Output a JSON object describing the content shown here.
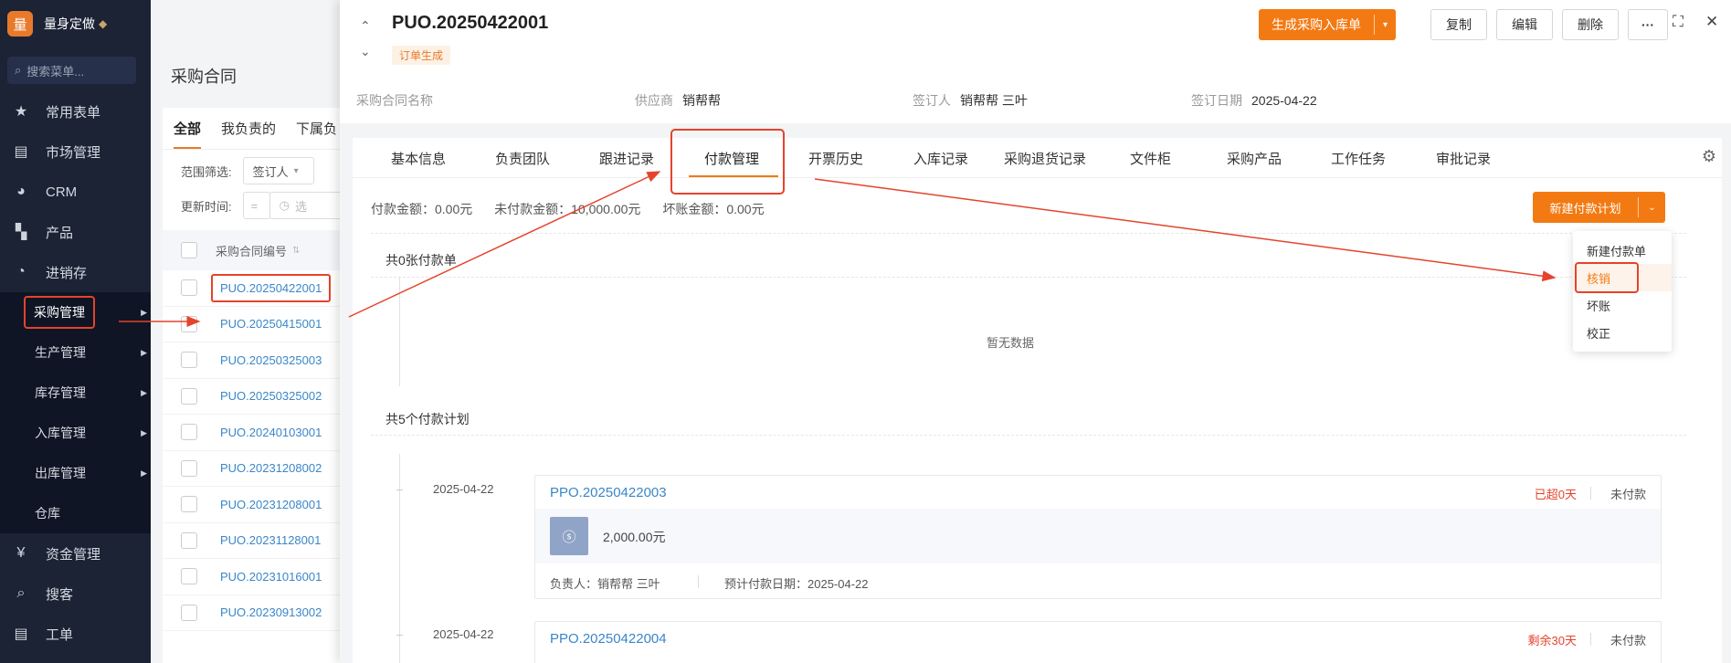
{
  "brand": {
    "logo_char": "量",
    "name": "量身定做"
  },
  "sidebar": {
    "search_placeholder": "搜索菜单...",
    "items": [
      {
        "label": "常用表单",
        "icon": "star-icon"
      },
      {
        "label": "市场管理",
        "icon": "clipboard-icon"
      },
      {
        "label": "CRM",
        "icon": "pie-icon"
      },
      {
        "label": "产品",
        "icon": "blocks-icon"
      },
      {
        "label": "进销存",
        "icon": "dashboard-icon"
      }
    ],
    "sub_items": [
      {
        "label": "采购管理",
        "has_arrow": true
      },
      {
        "label": "生产管理",
        "has_arrow": true
      },
      {
        "label": "库存管理",
        "has_arrow": true
      },
      {
        "label": "入库管理",
        "has_arrow": true
      },
      {
        "label": "出库管理",
        "has_arrow": true
      },
      {
        "label": "仓库",
        "has_arrow": false
      }
    ],
    "bottom_items": [
      {
        "label": "资金管理",
        "icon": "money-icon"
      },
      {
        "label": "搜客",
        "icon": "search-icon"
      },
      {
        "label": "工单",
        "icon": "clipboard-icon"
      }
    ]
  },
  "list_page": {
    "title": "采购合同",
    "tabs": [
      "全部",
      "我负责的",
      "下属负"
    ],
    "filter_label": "范围筛选:",
    "filter_value": "签订人",
    "time_label": "更新时间:",
    "date_placeholder": "选",
    "column_header": "采购合同编号",
    "rows": [
      "PUO.20250422001",
      "PUO.20250415001",
      "PUO.20250325003",
      "PUO.20250325002",
      "PUO.20240103001",
      "PUO.20231208002",
      "PUO.20231208001",
      "PUO.20231128001",
      "PUO.20231016001",
      "PUO.20230913002"
    ]
  },
  "detail": {
    "code": "PUO.20250422001",
    "status": "订单生成",
    "buttons": {
      "primary": "生成采购入库单",
      "copy": "复制",
      "edit": "编辑",
      "delete": "删除",
      "more": "···"
    },
    "info": {
      "contract_name_label": "采购合同名称",
      "contract_name_value": "",
      "supplier_label": "供应商",
      "supplier_value": "销帮帮",
      "signer_label": "签订人",
      "signer_value": "销帮帮 三叶",
      "date_label": "签订日期",
      "date_value": "2025-04-22"
    },
    "tabs": [
      "基本信息",
      "负责团队",
      "跟进记录",
      "付款管理",
      "开票历史",
      "入库记录",
      "采购退货记录",
      "文件柜",
      "采购产品",
      "工作任务",
      "审批记录"
    ],
    "summary": {
      "paid": "付款金额：0.00元",
      "unpaid": "未付款金额：10,000.00元",
      "bad_debt": "坏账金额：0.00元"
    },
    "new_plan_button": "新建付款计划",
    "dropdown": [
      "新建付款单",
      "核销",
      "坏账",
      "校正"
    ],
    "payments_title": "共0张付款单",
    "empty_text": "暂无数据",
    "plans_title": "共5个付款计划",
    "plans": [
      {
        "date": "2025-04-22",
        "code": "PPO.20250422003",
        "overdue": "已超0天",
        "state": "未付款",
        "amount": "2,000.00元",
        "owner": "负责人：销帮帮 三叶",
        "expected": "预计付款日期：2025-04-22"
      },
      {
        "date": "2025-04-22",
        "code": "PPO.20250422004",
        "overdue": "剩余30天",
        "state": "未付款"
      }
    ]
  },
  "colors": {
    "accent": "#f37a13",
    "annotation": "#e5432b",
    "link": "#3a86c8",
    "sidebar": "#1b2335"
  }
}
